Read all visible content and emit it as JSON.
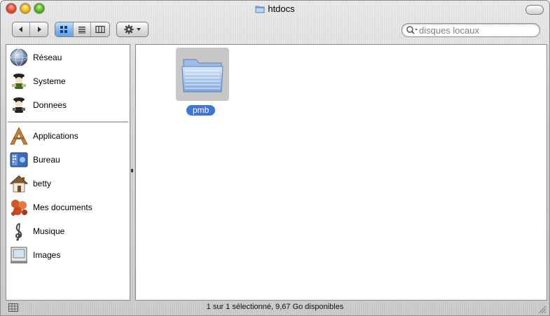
{
  "window": {
    "title": "htdocs",
    "title_icon": "folder-icon"
  },
  "toolbar": {
    "back_icon": "back-arrow-icon",
    "forward_icon": "forward-arrow-icon",
    "view_icons": [
      "icon-view-icon",
      "list-view-icon",
      "column-view-icon"
    ],
    "active_view": "icon-view",
    "action_icon": "gear-icon"
  },
  "search": {
    "placeholder": "disques locaux",
    "icon": "search-icon"
  },
  "sidebar": {
    "devices": [
      {
        "label": "Réseau",
        "icon": "network-globe-icon"
      },
      {
        "label": "Systeme",
        "icon": "disk-icon"
      },
      {
        "label": "Donnees",
        "icon": "disk-icon"
      }
    ],
    "places": [
      {
        "label": "Applications",
        "icon": "applications-icon"
      },
      {
        "label": "Bureau",
        "icon": "desktop-icon"
      },
      {
        "label": "betty",
        "icon": "home-icon"
      },
      {
        "label": "Mes documents",
        "icon": "documents-icon"
      },
      {
        "label": "Musique",
        "icon": "music-icon"
      },
      {
        "label": "Images",
        "icon": "pictures-icon"
      }
    ]
  },
  "content": {
    "items": [
      {
        "name": "pmb",
        "icon": "folder-icon",
        "selected": true
      }
    ]
  },
  "status": {
    "text": "1 sur 1 sélectionné, 9,67 Go disponibles"
  },
  "colors": {
    "selection": "#3d76d6",
    "active_view": "#78b4f2"
  }
}
